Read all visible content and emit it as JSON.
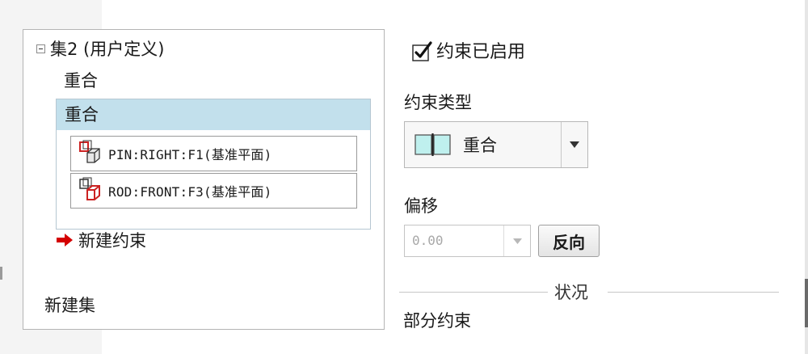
{
  "tree": {
    "set_label": "集2 (用户定义)",
    "constraint_label": "重合",
    "selected_label": "重合",
    "references": [
      "PIN:RIGHT:F1(基准平面)",
      "ROD:FRONT:F3(基准平面)"
    ],
    "new_constraint_label": "新建约束",
    "new_set_label": "新建集"
  },
  "properties": {
    "enabled_label": "约束已启用",
    "enabled_checked": true,
    "type_label": "约束类型",
    "type_value": "重合",
    "offset_label": "偏移",
    "offset_value": "0.00",
    "flip_label": "反向",
    "status_label": "状况",
    "status_value": "部分约束"
  },
  "colors": {
    "selection": "#c2e0ec",
    "arrow": "#d40000",
    "reference_icon": "#cc2222",
    "type_icon": "#bff0ee"
  }
}
